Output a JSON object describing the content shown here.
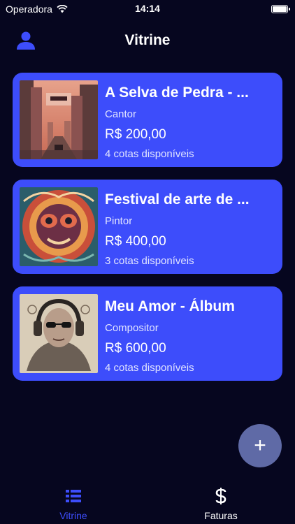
{
  "status_bar": {
    "carrier": "Operadora",
    "time": "14:14"
  },
  "header": {
    "title": "Vitrine"
  },
  "cards": [
    {
      "title": "A Selva de Pedra - ...",
      "role": "Cantor",
      "price": "R$ 200,00",
      "quota": "4 cotas disponíveis"
    },
    {
      "title": "Festival de arte de ...",
      "role": "Pintor",
      "price": "R$ 400,00",
      "quota": "3 cotas disponíveis"
    },
    {
      "title": "Meu Amor - Álbum",
      "role": "Compositor",
      "price": "R$ 600,00",
      "quota": "4 cotas disponíveis"
    }
  ],
  "fab": {
    "label": "+"
  },
  "tabs": [
    {
      "label": "Vitrine",
      "icon": "list-icon",
      "active": true
    },
    {
      "label": "Faturas",
      "icon": "dollar-icon",
      "active": false
    }
  ],
  "colors": {
    "background": "#06061f",
    "card": "#3d4dfb",
    "fab": "#5f6aa6",
    "tab_active": "#3d4dfb"
  }
}
